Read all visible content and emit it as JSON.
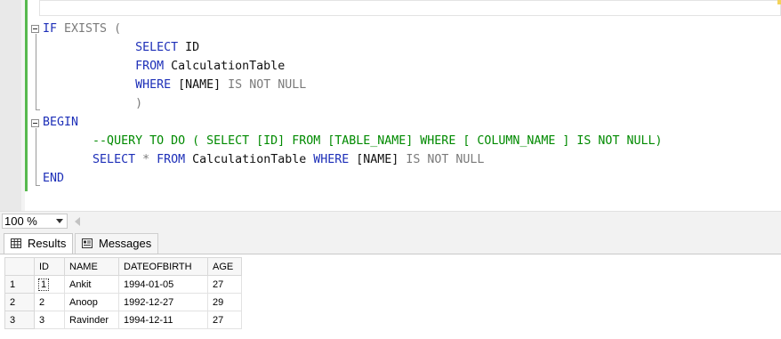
{
  "editor": {
    "lines": [
      [
        {
          "t": "IF ",
          "c": "kw"
        },
        {
          "t": "EXISTS (",
          "c": "gr"
        }
      ],
      [
        {
          "t": "             "
        },
        {
          "t": "SELECT ",
          "c": "kw"
        },
        {
          "t": "ID",
          "c": "tx"
        }
      ],
      [
        {
          "t": "             "
        },
        {
          "t": "FROM ",
          "c": "kw"
        },
        {
          "t": "CalculationTable",
          "c": "tx"
        }
      ],
      [
        {
          "t": "             "
        },
        {
          "t": "WHERE ",
          "c": "kw"
        },
        {
          "t": "[NAME] ",
          "c": "tx"
        },
        {
          "t": "IS NOT NULL",
          "c": "gr"
        }
      ],
      [
        {
          "t": "             "
        },
        {
          "t": ")",
          "c": "gr"
        }
      ],
      [
        {
          "t": "BEGIN",
          "c": "kw"
        }
      ],
      [
        {
          "t": "       "
        },
        {
          "t": "--QUERY TO DO ( SELECT [ID] FROM [TABLE_NAME] WHERE [ COLUMN_NAME ] IS NOT NULL)",
          "c": "cm"
        }
      ],
      [
        {
          "t": "       "
        },
        {
          "t": "SELECT ",
          "c": "kw"
        },
        {
          "t": "* ",
          "c": "gr"
        },
        {
          "t": "FROM ",
          "c": "kw"
        },
        {
          "t": "CalculationTable ",
          "c": "tx"
        },
        {
          "t": "WHERE ",
          "c": "kw"
        },
        {
          "t": "[NAME] ",
          "c": "tx"
        },
        {
          "t": "IS NOT NULL",
          "c": "gr"
        }
      ],
      [
        {
          "t": "END",
          "c": "kw"
        }
      ]
    ],
    "colors": {
      "keyword": "#1d2fb8",
      "operator": "#7a7a7a",
      "identifier": "#111111",
      "comment": "#008a00",
      "change_bar": "#57b94e"
    }
  },
  "zoom": {
    "value": "100 %"
  },
  "tabs": {
    "results": {
      "label": "Results",
      "icon": "grid-icon"
    },
    "messages": {
      "label": "Messages",
      "icon": "messages-icon"
    }
  },
  "grid": {
    "columns": [
      "ID",
      "NAME",
      "DATEOFBIRTH",
      "AGE"
    ],
    "rows": [
      {
        "num": "1",
        "cells": [
          "1",
          "Ankit",
          "1994-01-05",
          "27"
        ]
      },
      {
        "num": "2",
        "cells": [
          "2",
          "Anoop",
          "1992-12-27",
          "29"
        ]
      },
      {
        "num": "3",
        "cells": [
          "3",
          "Ravinder",
          "1994-12-11",
          "27"
        ]
      }
    ]
  }
}
